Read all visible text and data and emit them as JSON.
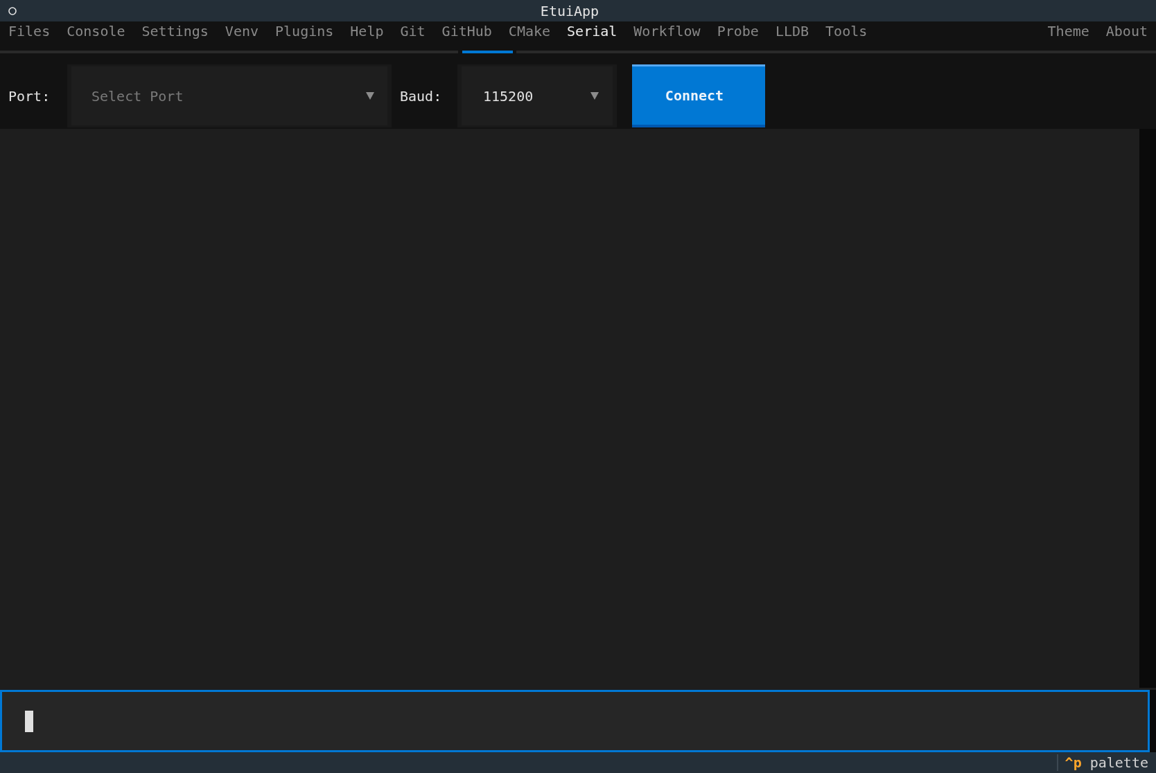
{
  "window": {
    "title": "EtuiApp"
  },
  "tabs": [
    {
      "label": "Files",
      "selected": false
    },
    {
      "label": "Console",
      "selected": false
    },
    {
      "label": "Settings",
      "selected": false
    },
    {
      "label": "Venv",
      "selected": false
    },
    {
      "label": "Plugins",
      "selected": false
    },
    {
      "label": "Help",
      "selected": false
    },
    {
      "label": "Git",
      "selected": false
    },
    {
      "label": "GitHub",
      "selected": false
    },
    {
      "label": "CMake",
      "selected": false
    },
    {
      "label": "Serial",
      "selected": true
    },
    {
      "label": "Workflow",
      "selected": false
    },
    {
      "label": "Probe",
      "selected": false
    },
    {
      "label": "LLDB",
      "selected": false
    },
    {
      "label": "Tools",
      "selected": false
    }
  ],
  "header_links": [
    "Theme",
    "About"
  ],
  "serial_toolbar": {
    "port": {
      "label": "Port:",
      "placeholder": "Select Port"
    },
    "baud": {
      "label": "Baud:",
      "value": "115200"
    },
    "connect_button": "Connect"
  },
  "command_input": {
    "focused": true
  },
  "footer": {
    "bindings": [
      {
        "key": "^p",
        "action": "palette"
      }
    ]
  }
}
